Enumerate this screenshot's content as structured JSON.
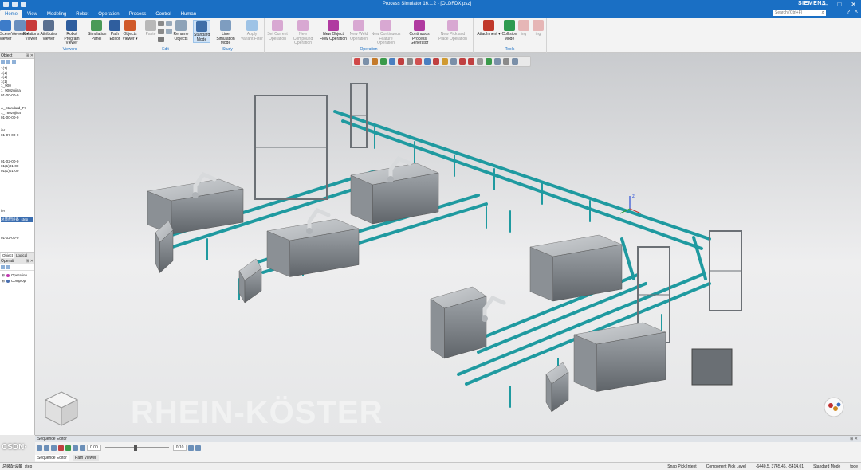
{
  "window": {
    "title": "Process Simulator 16.1.2 - [OLDFDX.psz]",
    "controls": [
      "—",
      "□",
      "✕"
    ]
  },
  "menu": {
    "tabs": [
      "Home",
      "View",
      "Modeling",
      "Robot",
      "Operation",
      "Process",
      "Control",
      "Human"
    ],
    "active": "Home",
    "brand": "SIEMENS",
    "search_placeholder": "Search (Ctrl+F)"
  },
  "ribbon": {
    "viewers": {
      "label": "Viewers",
      "buttons": [
        {
          "label": "Scene Viewer",
          "text": "Viewers ▾"
        },
        {
          "label": "Relations Viewer"
        },
        {
          "label": "Attributes Viewer"
        },
        {
          "label": "Robot Program Viewer"
        },
        {
          "label": "Simulation Panel"
        },
        {
          "label": "Path Editor"
        },
        {
          "label": "Objects Viewer ▾"
        }
      ]
    },
    "edit": {
      "label": "Edit",
      "buttons": [
        {
          "label": "Paste"
        },
        {
          "label": "Rename Objects"
        }
      ]
    },
    "study": {
      "label": "Study",
      "buttons": [
        {
          "label": "Standard Mode"
        },
        {
          "label": "Line Simulation Mode"
        },
        {
          "label": "Apply Variant Filter"
        }
      ]
    },
    "operation": {
      "label": "Operation",
      "buttons": [
        {
          "label": "Set Current Operation"
        },
        {
          "label": "New Compound Operation"
        },
        {
          "label": "New Object Flow Operation"
        },
        {
          "label": "New Weld Operation"
        },
        {
          "label": "New Continuous Feature Operation"
        },
        {
          "label": "Continuous Process Generator"
        },
        {
          "label": "New Pick and Place Operation"
        }
      ]
    },
    "tools": {
      "label": "Tools",
      "buttons": [
        {
          "label": "Attachment ▾"
        },
        {
          "label": "Collision Mode"
        },
        {
          "label": "ing"
        },
        {
          "label": "ing"
        }
      ]
    }
  },
  "object_tree": {
    "header": "Object",
    "items": [
      "1(1)",
      "1(1)",
      "1(1)",
      "1(1)",
      "1_900",
      "1_900zujina",
      "01-00-00-0",
      "",
      "",
      "A_Standard_Fr",
      "1_780zujina",
      "01-00-00-0",
      "",
      "",
      "ier",
      "01-07-00-0",
      "",
      "",
      "",
      "",
      "",
      "01-02-00-0",
      "01(1)01-00",
      "01(1)01-00",
      "",
      "",
      "",
      "",
      "",
      "",
      "",
      "",
      "ier",
      "",
      "",
      "",
      "",
      "01-02-00-0"
    ],
    "highlighted": "总装配设备_step",
    "tabs": [
      "Object",
      "Logical"
    ]
  },
  "operation_tree": {
    "header": "Operati",
    "items": [
      "Operation",
      "CompOp"
    ]
  },
  "sequence_editor": {
    "header": "Sequence Editor",
    "time_value": "0.00",
    "step_value": "0.10",
    "tabs": [
      "Sequence Editor",
      "Path Viewer"
    ]
  },
  "status": {
    "left": "总装配设备_step",
    "items": [
      "Snap Pick Intent",
      "Component Pick Level",
      "-6440.5, 3745.46, -5414.01",
      "Standard Mode",
      "fode"
    ]
  },
  "watermark": "RHEIN-KÖSTER",
  "logo": "CSDN·"
}
